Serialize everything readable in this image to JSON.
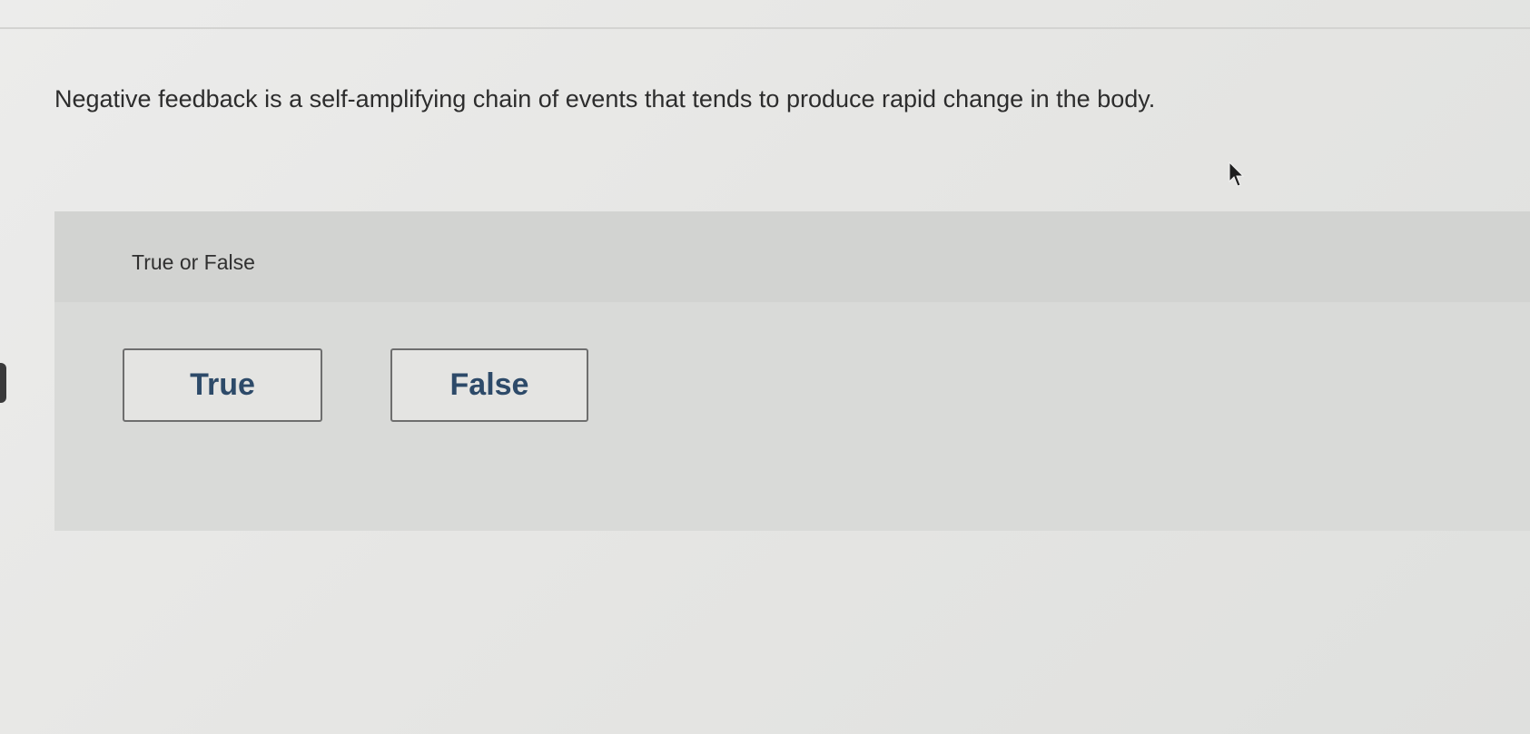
{
  "question": {
    "text": "Negative feedback is a self-amplifying chain of events that tends to produce rapid change in the body."
  },
  "answer_panel": {
    "label": "True or False",
    "choices": [
      {
        "label": "True"
      },
      {
        "label": "False"
      }
    ]
  },
  "colors": {
    "choice_text": "#2d4a69",
    "panel": "#d9dad8",
    "background": "#e6e6e4"
  },
  "icons": {
    "cursor": "mouse-pointer-icon"
  }
}
